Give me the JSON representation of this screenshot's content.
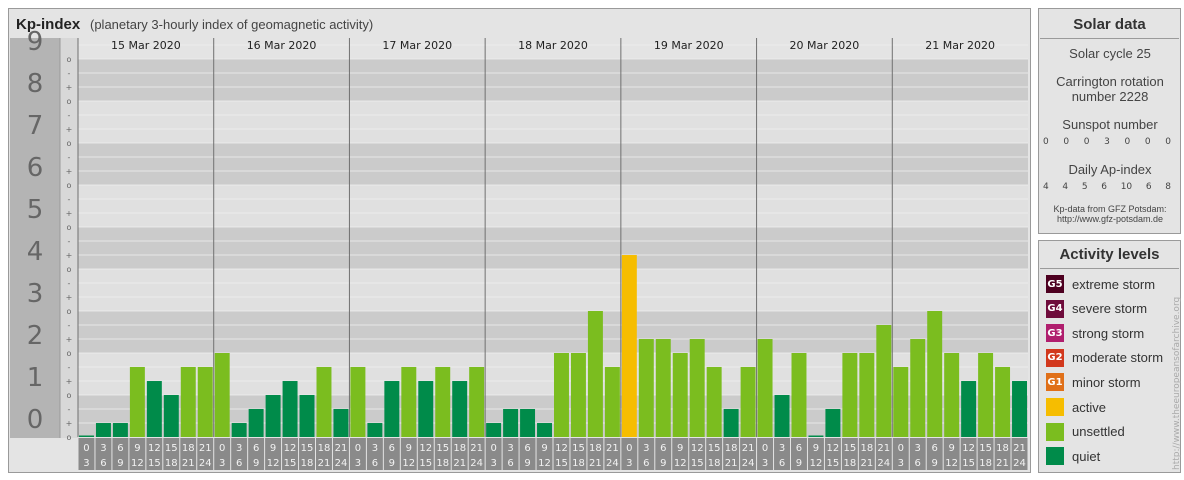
{
  "header": {
    "title": "Kp-index",
    "subtitle": "(planetary 3-hourly index of geomagnetic activity)"
  },
  "solar_data": {
    "title": "Solar data",
    "cycle": "Solar cycle 25",
    "carrington_1": "Carrington rotation",
    "carrington_2": "number 2228",
    "sunspot_label": "Sunspot number",
    "sunspot_values": [
      "0",
      "0",
      "0",
      "3",
      "0",
      "0",
      "0"
    ],
    "ap_label": "Daily Ap-index",
    "ap_values": [
      "4",
      "4",
      "5",
      "6",
      "10",
      "6",
      "8"
    ],
    "source_1": "Kp-data from GFZ Potsdam:",
    "source_2": "http://www.gfz-potsdam.de"
  },
  "activity_levels": {
    "title": "Activity levels",
    "items": [
      {
        "code": "G5",
        "label": "extreme storm",
        "color": "#4d0020"
      },
      {
        "code": "G4",
        "label": "severe storm",
        "color": "#6e0b3b"
      },
      {
        "code": "G3",
        "label": "strong storm",
        "color": "#b01e6e"
      },
      {
        "code": "G2",
        "label": "moderate storm",
        "color": "#d2381d"
      },
      {
        "code": "G1",
        "label": "minor storm",
        "color": "#e07019"
      },
      {
        "code": "",
        "label": "active",
        "color": "#f6bd00"
      },
      {
        "code": "",
        "label": "unsettled",
        "color": "#7bbd1f"
      },
      {
        "code": "",
        "label": "quiet",
        "color": "#008b4a"
      }
    ]
  },
  "watermark": "http://www.theeuropeansofarchive.org",
  "chart_data": {
    "type": "bar",
    "title": "Kp-index",
    "ylim": [
      0,
      9
    ],
    "y_major_ticks": [
      "0",
      "1",
      "2",
      "3",
      "4",
      "5",
      "6",
      "7",
      "8",
      "9"
    ],
    "y_minor_labels": [
      "o",
      "+",
      "-",
      "o"
    ],
    "days": [
      "15 Mar 2020",
      "16 Mar 2020",
      "17 Mar 2020",
      "18 Mar 2020",
      "19 Mar 2020",
      "20 Mar 2020",
      "21 Mar 2020"
    ],
    "slot_top": [
      "0",
      "3",
      "6",
      "9",
      "12",
      "15",
      "18",
      "21"
    ],
    "slot_bottom": [
      "3",
      "6",
      "9",
      "12",
      "15",
      "18",
      "21",
      "24"
    ],
    "values": [
      0.0,
      0.333,
      0.333,
      1.667,
      1.333,
      1.0,
      1.667,
      1.667,
      2.0,
      0.333,
      0.667,
      1.0,
      1.333,
      1.0,
      1.667,
      0.667,
      1.667,
      0.333,
      1.333,
      1.667,
      1.333,
      1.667,
      1.333,
      1.667,
      0.333,
      0.667,
      0.667,
      0.333,
      2.0,
      2.0,
      3.0,
      1.667,
      4.333,
      2.333,
      2.333,
      2.0,
      2.333,
      1.667,
      0.667,
      1.667,
      2.333,
      1.0,
      2.0,
      0.0,
      0.667,
      2.0,
      2.0,
      2.667,
      1.667,
      2.333,
      3.0,
      2.0,
      1.333,
      2.0,
      1.667,
      1.333
    ],
    "colors": {
      "quiet": "#008b4a",
      "unsettled": "#7bbd1f",
      "active": "#f6bd00"
    },
    "thresholds": {
      "unsettled": 1.667,
      "active": 3.667
    }
  }
}
